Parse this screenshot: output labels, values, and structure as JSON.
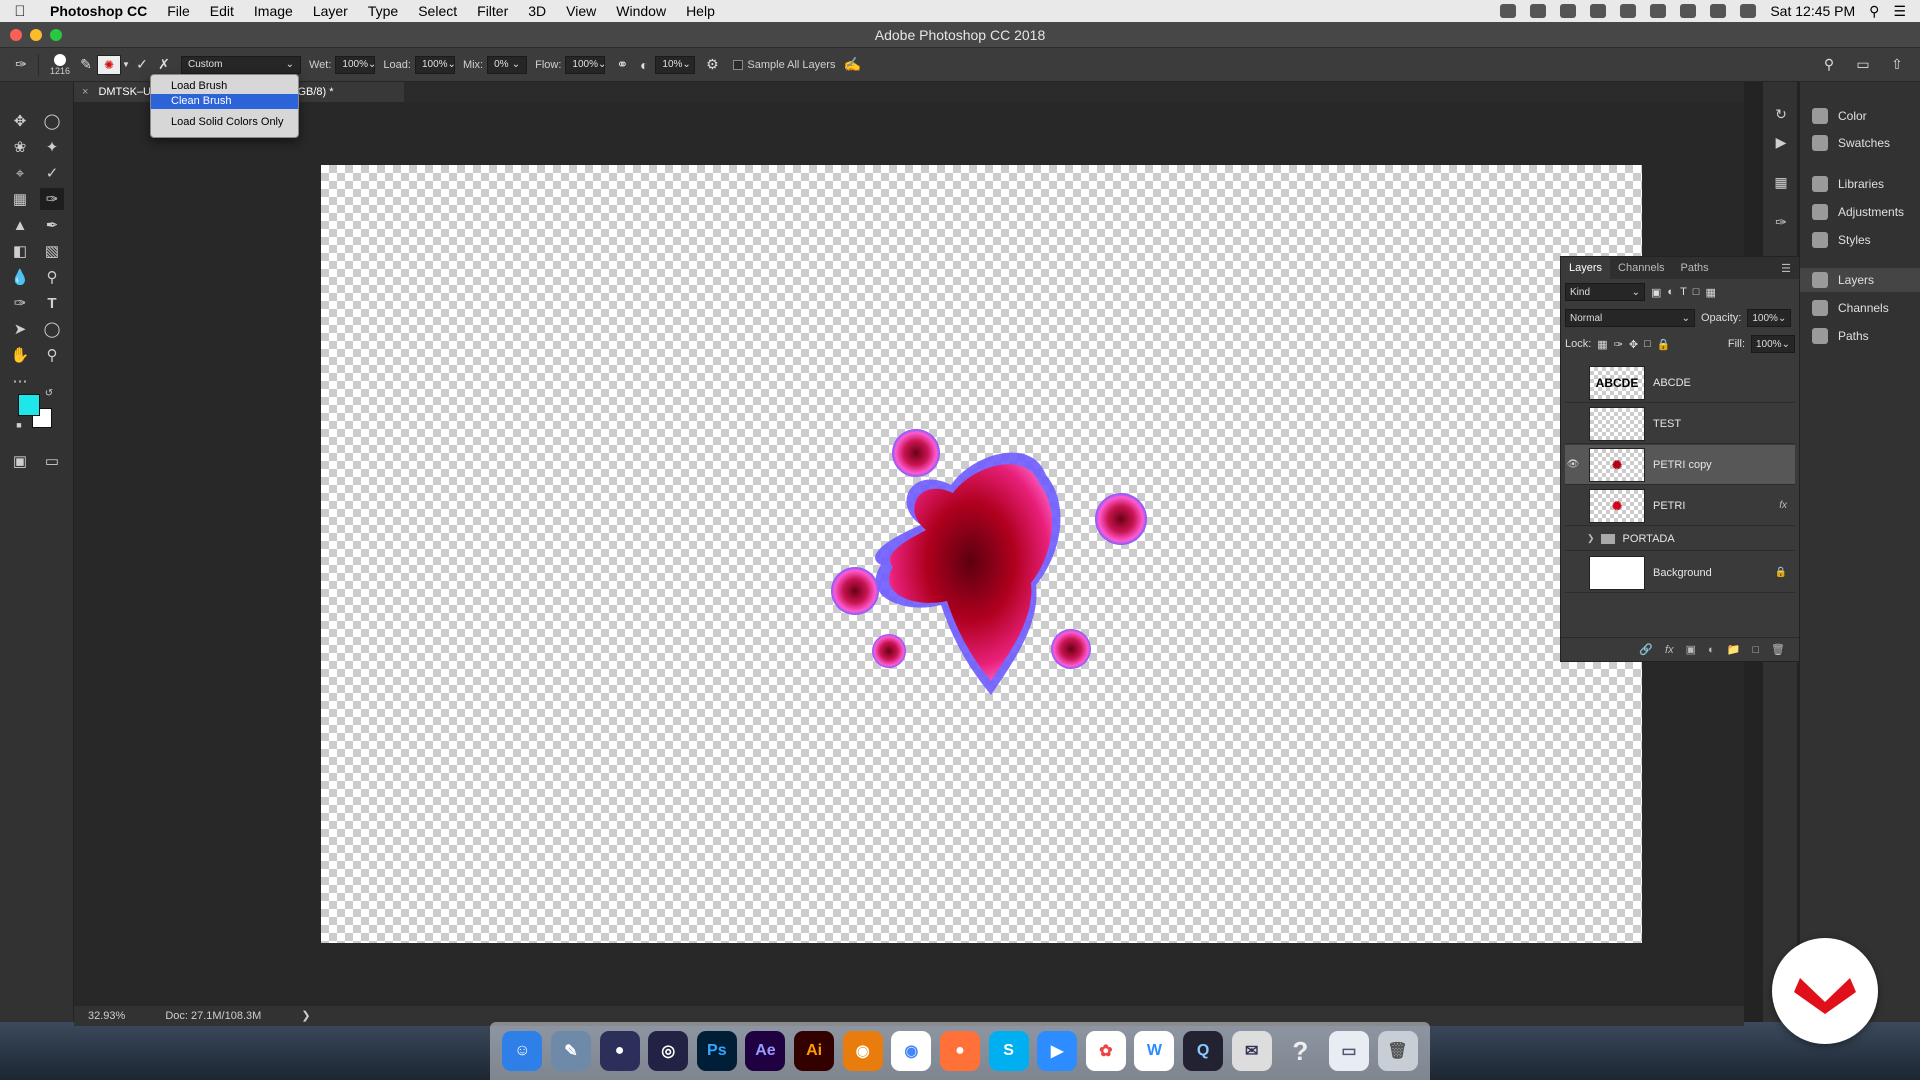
{
  "menubar": {
    "app_name": "Photoshop CC",
    "items": [
      "File",
      "Edit",
      "Image",
      "Layer",
      "Type",
      "Select",
      "Filter",
      "3D",
      "View",
      "Window",
      "Help"
    ],
    "clock": "Sat 12:45 PM"
  },
  "window": {
    "title": "Adobe Photoshop CC 2018"
  },
  "options": {
    "brush_size": "1216",
    "preset": "Custom",
    "wet_label": "Wet:",
    "wet_value": "100%",
    "load_label": "Load:",
    "load_value": "100%",
    "mix_label": "Mix:",
    "mix_value": "0%",
    "flow_label": "Flow:",
    "flow_value": "100%",
    "smoothing_value": "10%",
    "sample_all_layers": "Sample All Layers"
  },
  "brush_menu": {
    "items": [
      "Load Brush",
      "Clean Brush",
      "Load Solid Colors Only"
    ],
    "highlighted": "Clean Brush"
  },
  "document_tab": {
    "name_left": "DMTSK–U",
    "name_right": "copy, RGB/8) *"
  },
  "status": {
    "zoom": "32.93%",
    "doc": "Doc: 27.1M/108.3M"
  },
  "colors": {
    "foreground": "#1fe6ea",
    "background": "#ffffff",
    "highlight": "#2d63d8"
  },
  "right_panel": {
    "items": [
      "Color",
      "Swatches",
      "Libraries",
      "Adjustments",
      "Styles",
      "Layers",
      "Channels",
      "Paths"
    ],
    "active": "Layers"
  },
  "layers_panel": {
    "tabs": [
      "Layers",
      "Channels",
      "Paths"
    ],
    "filter_kind": "Kind",
    "blend_mode": "Normal",
    "opacity_label": "Opacity:",
    "opacity_value": "100%",
    "lock_label": "Lock:",
    "fill_label": "Fill:",
    "fill_value": "100%",
    "layers": [
      {
        "name": "ABCDE",
        "thumb_text": "ABCDE",
        "visible": false
      },
      {
        "name": "TEST",
        "visible": false
      },
      {
        "name": "PETRI copy",
        "visible": true,
        "selected": true
      },
      {
        "name": "PETRI",
        "visible": false,
        "fx": "fx"
      },
      {
        "name": "PORTADA",
        "group": true
      },
      {
        "name": "Background",
        "locked": true
      }
    ]
  },
  "dock": {
    "apps": [
      {
        "icon": "finder-icon",
        "label": ""
      },
      {
        "icon": "preview-icon",
        "label": ""
      },
      {
        "icon": "siri-icon",
        "label": ""
      },
      {
        "icon": "safari-icon",
        "label": ""
      },
      {
        "icon": "photoshop-icon",
        "label": "Ps"
      },
      {
        "icon": "after-effects-icon",
        "label": "Ae"
      },
      {
        "icon": "illustrator-icon",
        "label": "Ai"
      },
      {
        "icon": "blender-icon",
        "label": ""
      },
      {
        "icon": "chrome-icon",
        "label": ""
      },
      {
        "icon": "firefox-icon",
        "label": ""
      },
      {
        "icon": "skype-icon",
        "label": ""
      },
      {
        "icon": "zoom-icon",
        "label": ""
      },
      {
        "icon": "photos-icon",
        "label": ""
      },
      {
        "icon": "w-app-icon",
        "label": ""
      },
      {
        "icon": "quicktime-icon",
        "label": ""
      },
      {
        "icon": "mail-icon",
        "label": ""
      },
      {
        "icon": "help-icon",
        "label": ""
      },
      {
        "icon": "folder-icon",
        "label": ""
      },
      {
        "icon": "trash-icon",
        "label": ""
      }
    ]
  }
}
